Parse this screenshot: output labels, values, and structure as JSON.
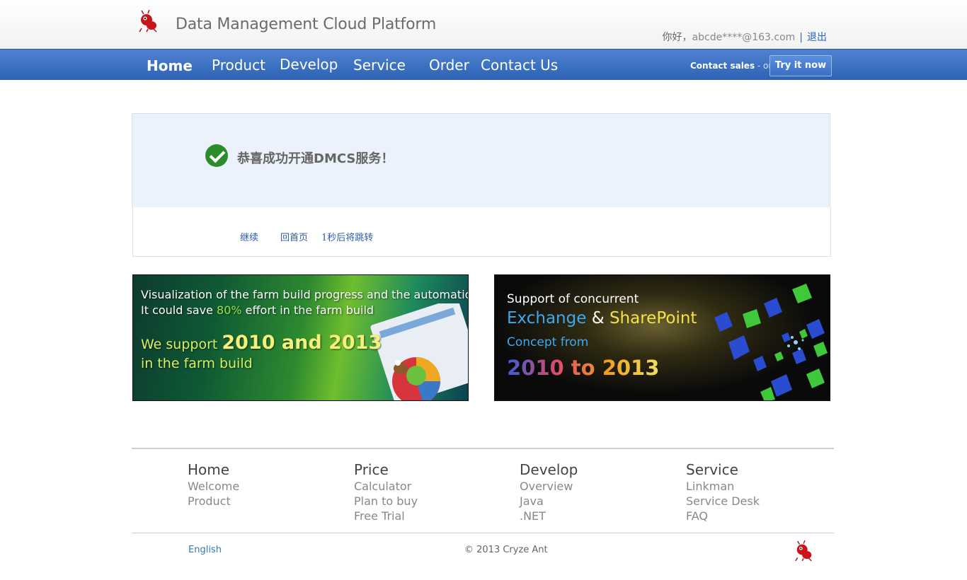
{
  "header": {
    "site_title": "Data Management Cloud Platform",
    "greeting": "你好，",
    "user_email": "abcde****@163.com",
    "separator": "|",
    "logout": "退出"
  },
  "nav": {
    "items": [
      "Home",
      "Product",
      "Develop",
      "Service",
      "Order",
      "Contact Us"
    ],
    "active": "Home",
    "contact_sales": "Contact sales",
    "or": " - or - ",
    "try_button": "Try it now"
  },
  "success": {
    "message": "恭喜成功开通DMCS服务！",
    "continue": "继续",
    "home": "回首页",
    "countdown": "1秒后将跳转"
  },
  "banners": {
    "farm": {
      "line1": "Visualization of the farm build progress and the automation",
      "line2_pre": "It could save ",
      "line2_hl": "80%",
      "line2_post": " effort in the farm build",
      "line3_pre": "We support ",
      "line3_hl": "2010 and 2013",
      "line4": "in the farm build"
    },
    "sharepoint": {
      "line1": "Support of concurrent",
      "line2_a": "Exchange",
      "line2_amp": " & ",
      "line2_b": "SharePoint",
      "line3": "Concept from",
      "line4": "2010 to 2013"
    }
  },
  "footer": {
    "columns": [
      {
        "heading": "Home",
        "links": [
          "Welcome",
          "Product"
        ]
      },
      {
        "heading": "Price",
        "links": [
          "Calculator",
          "Plan to buy",
          "Free Trial"
        ]
      },
      {
        "heading": "Develop",
        "links": [
          "Overview",
          "Java",
          ".NET"
        ]
      },
      {
        "heading": "Service",
        "links": [
          "Linkman",
          "Service Desk",
          "FAQ"
        ]
      }
    ],
    "language": "English",
    "copyright": "© 2013 Cryze Ant"
  },
  "colors": {
    "nav_blue": "#2d62b4",
    "success_green": "#2b8c2b",
    "link_blue": "#2d5ea8"
  }
}
